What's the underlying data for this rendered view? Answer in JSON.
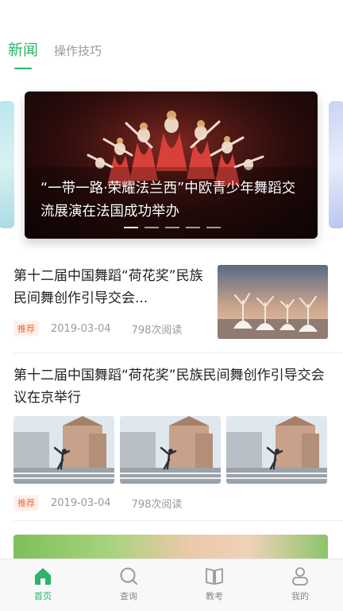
{
  "tabs": [
    {
      "label": "新闻",
      "active": true
    },
    {
      "label": "操作技巧",
      "active": false
    }
  ],
  "carousel": {
    "title": "“一带一路·荣耀法兰西”中欧青少年舞蹈交流展演在法国成功举办",
    "dot_count": 5,
    "active_dot": 0
  },
  "news": [
    {
      "title": "第十二届中国舞蹈“荷花奖”民族民间舞创作引导交会...",
      "badge": "推荐",
      "date": "2019-03-04",
      "reads": "798次阅读",
      "thumb_icon": "ballet-photo"
    },
    {
      "title": "第十二届中国舞蹈“荷花奖”民族民间舞创作引导交会议在京举行",
      "badge": "推荐",
      "date": "2019-03-04",
      "reads": "798次阅读",
      "thumb_icon": "street-dance-photo"
    }
  ],
  "bottom_nav": [
    {
      "label": "首页",
      "icon": "home-icon",
      "active": true
    },
    {
      "label": "查询",
      "icon": "search-icon",
      "active": false
    },
    {
      "label": "教考",
      "icon": "book-icon",
      "active": false
    },
    {
      "label": "我的",
      "icon": "user-icon",
      "active": false
    }
  ],
  "colors": {
    "accent": "#2db36a",
    "badge_text": "#e86a3a",
    "badge_bg": "#fff1ec"
  }
}
